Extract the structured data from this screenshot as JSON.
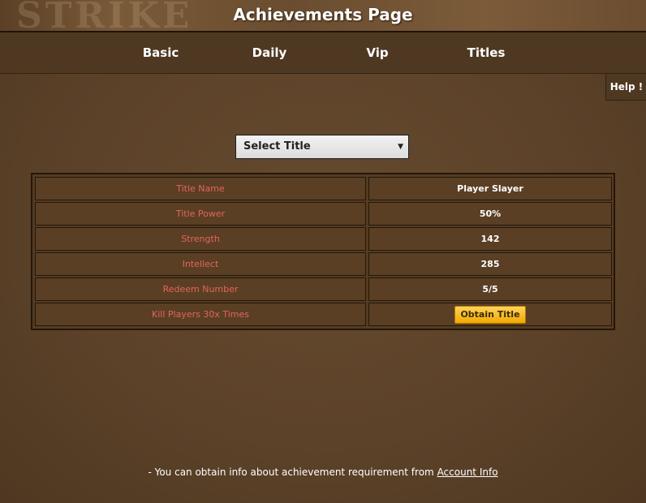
{
  "header": {
    "title": "Achievements Page",
    "watermark": "STRIKE"
  },
  "nav": {
    "items": [
      {
        "label": "Basic"
      },
      {
        "label": "Daily"
      },
      {
        "label": "Vip"
      },
      {
        "label": "Titles"
      }
    ]
  },
  "help": {
    "label": "Help !"
  },
  "select": {
    "value": "Select Title",
    "arrow": "▼"
  },
  "table": {
    "rows": [
      {
        "label": "Title Name",
        "value": "Player Slayer"
      },
      {
        "label": "Title Power",
        "value": "50%"
      },
      {
        "label": "Strength",
        "value": "142"
      },
      {
        "label": "Intellect",
        "value": "285"
      },
      {
        "label": "Redeem Number",
        "value": "5/5"
      },
      {
        "label": "Kill Players 30x Times",
        "button": "Obtain Title"
      }
    ]
  },
  "footer": {
    "text": "- You can obtain info about achievement requirement from ",
    "link": "Account Info"
  },
  "colors": {
    "label_text": "#e5645a",
    "button_gold": "#f2a900",
    "background": "#5c4229"
  }
}
